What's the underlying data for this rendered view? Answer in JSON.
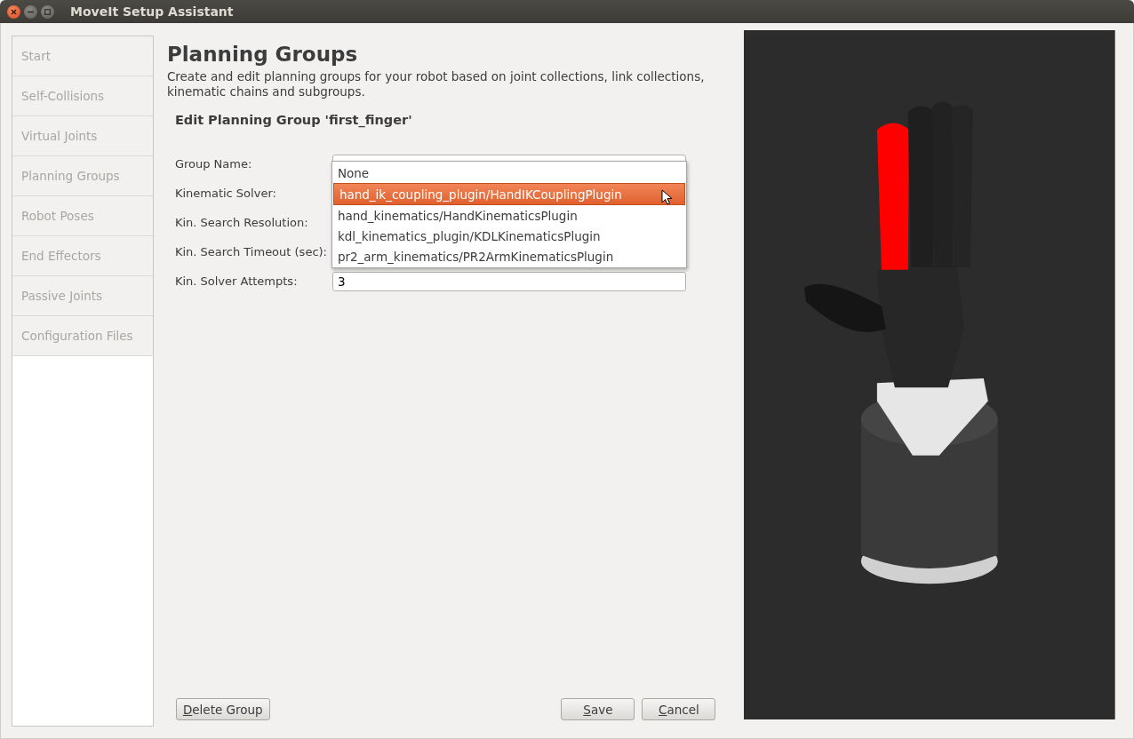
{
  "window": {
    "title": "MoveIt Setup Assistant"
  },
  "sidebar": {
    "items": [
      {
        "label": "Start"
      },
      {
        "label": "Self-Collisions"
      },
      {
        "label": "Virtual Joints"
      },
      {
        "label": "Planning Groups"
      },
      {
        "label": "Robot Poses"
      },
      {
        "label": "End Effectors"
      },
      {
        "label": "Passive Joints"
      },
      {
        "label": "Configuration Files"
      }
    ]
  },
  "header": {
    "title": "Planning Groups",
    "description": "Create and edit planning groups for your robot based on joint collections, link collections, kinematic chains and subgroups."
  },
  "form": {
    "title": "Edit Planning Group 'first_finger'",
    "fields": [
      {
        "label": "Group Name:"
      },
      {
        "label": "Kinematic Solver:"
      },
      {
        "label": "Kin. Search Resolution:"
      },
      {
        "label": "Kin. Search Timeout (sec):"
      },
      {
        "label": "Kin. Solver Attempts:",
        "value": "3"
      }
    ]
  },
  "dropdown": {
    "options": [
      {
        "label": "None",
        "selected": false
      },
      {
        "label": "hand_ik_coupling_plugin/HandIKCouplingPlugin",
        "selected": true
      },
      {
        "label": "hand_kinematics/HandKinematicsPlugin",
        "selected": false
      },
      {
        "label": "kdl_kinematics_plugin/KDLKinematicsPlugin",
        "selected": false
      },
      {
        "label": "pr2_arm_kinematics/PR2ArmKinematicsPlugin",
        "selected": false
      }
    ]
  },
  "buttons": {
    "left": [
      {
        "label": "Delete Group"
      }
    ],
    "right": [
      {
        "label": "Save"
      },
      {
        "label": "Cancel"
      }
    ]
  }
}
